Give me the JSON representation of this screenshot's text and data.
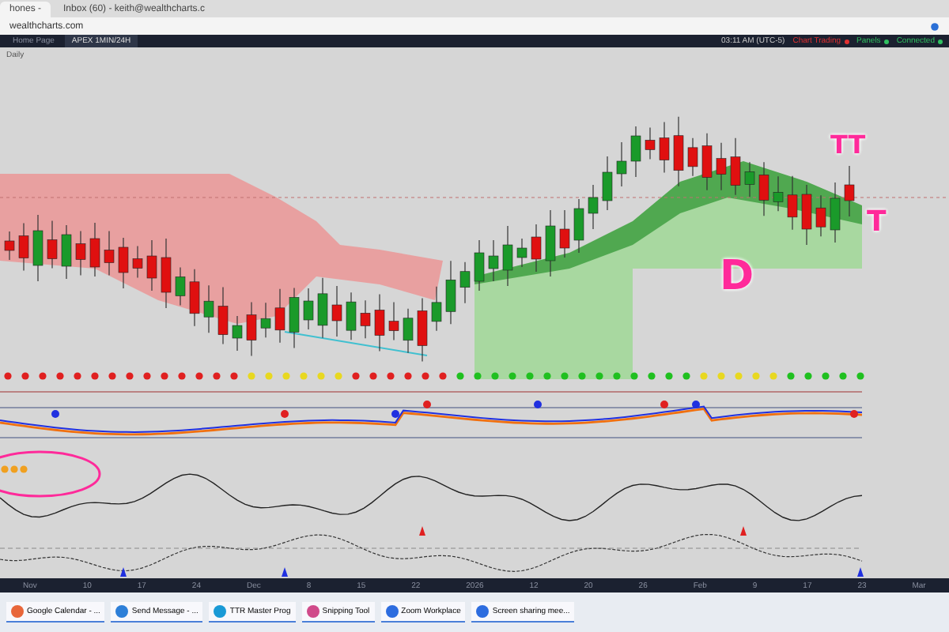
{
  "browser_tabs": [
    {
      "label": "hones - ",
      "selected": true
    },
    {
      "label": "Inbox (60) - keith@wealthcharts.c",
      "selected": false
    }
  ],
  "address": "wealthcharts.com",
  "app_tabs": [
    {
      "label": "Home Page",
      "selected": false
    },
    {
      "label": "APEX 1MIN/24H",
      "selected": true
    }
  ],
  "status": [
    {
      "label": "03:11 AM (UTC-5)"
    },
    {
      "label": "Chart Trading",
      "color": "#e03030"
    },
    {
      "label": "Panels",
      "color": "#30c060"
    },
    {
      "label": "Connected",
      "color": "#30c060"
    }
  ],
  "chart": {
    "interval": "Daily",
    "annotations": [
      {
        "text": "TT",
        "kind": "high"
      },
      {
        "text": "T",
        "kind": "mid"
      },
      {
        "text": "D",
        "kind": "low"
      }
    ]
  },
  "x_axis": [
    "Nov",
    "10",
    "17",
    "24",
    "Dec",
    "8",
    "15",
    "22",
    "2026",
    "12",
    "20",
    "26",
    "Feb",
    "9",
    "17",
    "23",
    "Mar"
  ],
  "taskbar": [
    {
      "label": "Google Calendar - ...",
      "color": "#e8663a"
    },
    {
      "label": "Send Message - ...",
      "color": "#2d7fd8"
    },
    {
      "label": "TTR Master Prog",
      "color": "#1a9ad6"
    },
    {
      "label": "Snipping Tool",
      "color": "#d04a8a"
    },
    {
      "label": "Zoom Workplace",
      "color": "#2d6cdf"
    },
    {
      "label": "Screen sharing mee...",
      "color": "#2d6cdf"
    }
  ]
}
